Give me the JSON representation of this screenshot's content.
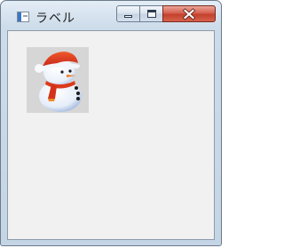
{
  "window": {
    "title": "ラベル",
    "app_icon": "window-app-icon",
    "controls": {
      "minimize_icon": "minimize-icon",
      "maximize_icon": "maximize-icon",
      "close_icon": "close-icon"
    }
  },
  "content": {
    "picture_icon": "snowman-icon"
  },
  "colors": {
    "client_background": "#f1f1f1",
    "close_button": "#c3402c",
    "picture_background": "#d6d6d6"
  }
}
